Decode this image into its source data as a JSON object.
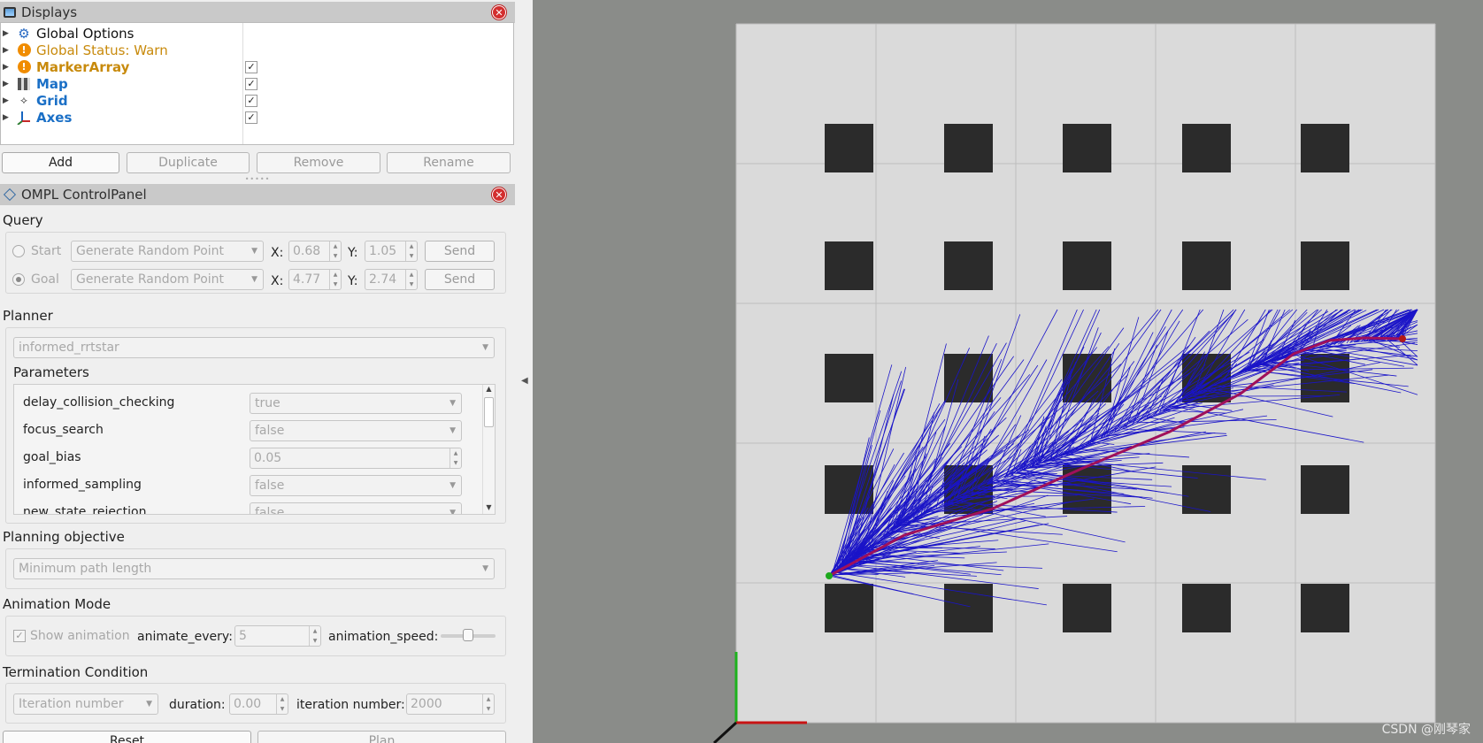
{
  "displays": {
    "title": "Displays",
    "items": [
      {
        "label": "Global Options",
        "color": "#111111",
        "icon": "gear-icon",
        "checkbox": null
      },
      {
        "label": "Global Status: Warn",
        "color": "#c88a0c",
        "icon": "warning-icon",
        "checkbox": null
      },
      {
        "label": "MarkerArray",
        "color": "#c88a0c",
        "icon": "warning-icon",
        "checkbox": "✓",
        "bold": true
      },
      {
        "label": "Map",
        "color": "#1a6fc6",
        "icon": "map-icon",
        "checkbox": "✓",
        "bold": true
      },
      {
        "label": "Grid",
        "color": "#1a6fc6",
        "icon": "grid-icon",
        "checkbox": "✓",
        "bold": true
      },
      {
        "label": "Axes",
        "color": "#1a6fc6",
        "icon": "axes-icon",
        "checkbox": "✓",
        "bold": true
      }
    ],
    "buttons": {
      "add": "Add",
      "duplicate": "Duplicate",
      "remove": "Remove",
      "rename": "Rename"
    }
  },
  "ompl": {
    "title": "OMPL ControlPanel",
    "query": {
      "label": "Query",
      "start": {
        "label": "Start",
        "mode": "Generate Random Point",
        "x": "0.68",
        "y": "1.05",
        "send": "Send"
      },
      "goal": {
        "label": "Goal",
        "mode": "Generate Random Point",
        "x": "4.77",
        "y": "2.74",
        "send": "Send"
      },
      "x_label": "X:",
      "y_label": "Y:"
    },
    "planner": {
      "label": "Planner",
      "selected": "informed_rrtstar",
      "params_label": "Parameters",
      "params": [
        {
          "name": "delay_collision_checking",
          "value": "true",
          "kind": "combo"
        },
        {
          "name": "focus_search",
          "value": "false",
          "kind": "combo"
        },
        {
          "name": "goal_bias",
          "value": "0.05",
          "kind": "spin"
        },
        {
          "name": "informed_sampling",
          "value": "false",
          "kind": "combo"
        },
        {
          "name": "new_state_rejection",
          "value": "false",
          "kind": "combo"
        }
      ]
    },
    "objective": {
      "label": "Planning objective",
      "selected": "Minimum path length"
    },
    "animation": {
      "label": "Animation Mode",
      "show": "Show animation",
      "every_label": "animate_every:",
      "every_value": "5",
      "speed_label": "animation_speed:",
      "speed_fraction": 0.5
    },
    "termination": {
      "label": "Termination Condition",
      "mode": "Iteration number",
      "duration_label": "duration:",
      "duration_value": "0.00",
      "iter_label": "iteration number:",
      "iter_value": "2000"
    },
    "buttons": {
      "reset": "Reset",
      "plan": "Plan"
    }
  },
  "viewport": {
    "watermark": "CSDN @刚琴家",
    "colors": {
      "obstacle": "#2b2b2b",
      "map": "#dadada",
      "tree": "#1a14c8",
      "path": "#a0105a",
      "start": "#1ca81c",
      "goal": "#b21818"
    }
  }
}
